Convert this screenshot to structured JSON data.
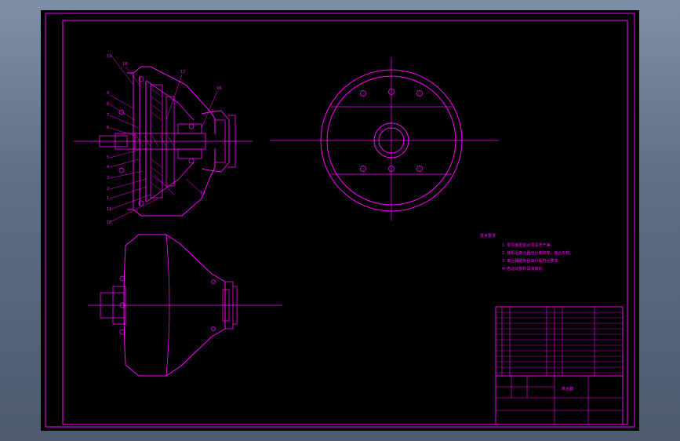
{
  "drawing": {
    "title": "离合器",
    "title_code": "",
    "notes_heading": "技术要求",
    "notes": [
      "1. 零件装配前必须清洗干净。",
      "2. 装配后离合器应分离彻底，接合平稳。",
      "3. 离合器踏板自由行程符合要求。",
      "4. 各运动部件润滑良好。"
    ],
    "school": "",
    "scale": "",
    "sheet": ""
  },
  "colors": {
    "line": "#ff00ff",
    "background": "#000000",
    "window": "#6a7a94"
  }
}
